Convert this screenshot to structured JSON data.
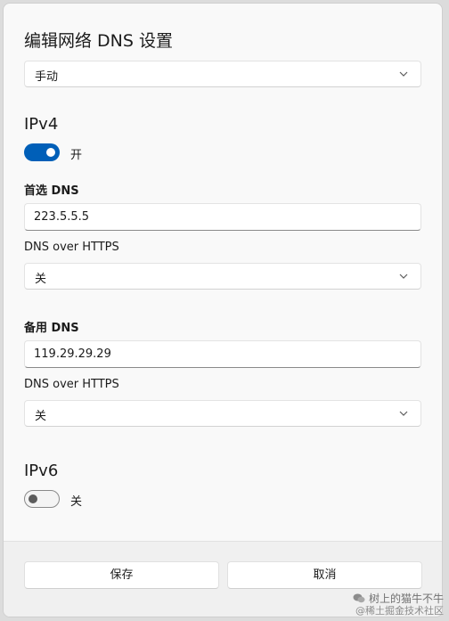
{
  "dialog": {
    "title": "编辑网络 DNS 设置",
    "mode_select": {
      "value": "手动"
    }
  },
  "ipv4": {
    "heading": "IPv4",
    "toggle_label": "开",
    "toggle_state": "on",
    "preferred": {
      "label": "首选 DNS",
      "value": "223.5.5.5",
      "doh_label": "DNS over HTTPS",
      "doh_value": "关"
    },
    "alternate": {
      "label": "备用 DNS",
      "value": "119.29.29.29",
      "doh_label": "DNS over HTTPS",
      "doh_value": "关"
    }
  },
  "ipv6": {
    "heading": "IPv6",
    "toggle_label": "关",
    "toggle_state": "off"
  },
  "footer": {
    "save_label": "保存",
    "cancel_label": "取消"
  },
  "watermark": {
    "line1": "树上的猫牛不牛",
    "line2": "@稀土掘金技术社区"
  },
  "icons": {
    "chevron": "chevron-down-icon",
    "wechat": "wechat-icon"
  },
  "colors": {
    "accent": "#005fb8",
    "dialog_bg": "#f9f9f9",
    "footer_bg": "#f0f0f0"
  }
}
